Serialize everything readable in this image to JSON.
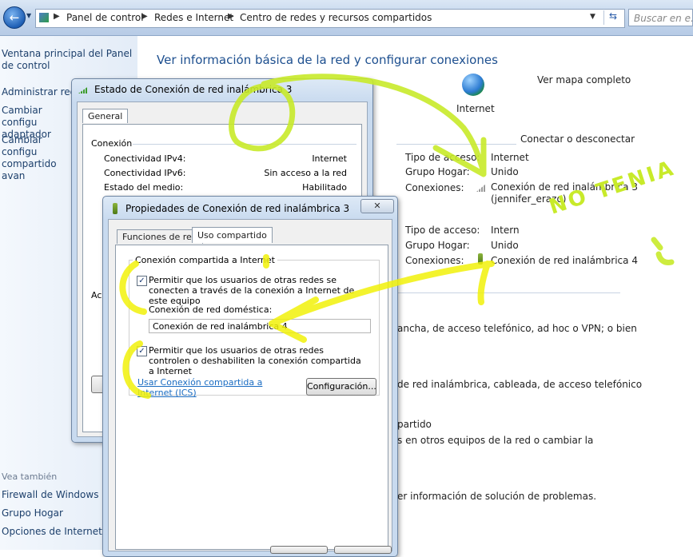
{
  "addressbar": {
    "crumbs": [
      "Panel de control",
      "Redes e Internet",
      "Centro de redes y recursos compartidos"
    ],
    "search_placeholder": "Buscar en e..."
  },
  "leftpane": {
    "items": [
      "Ventana principal del Panel de control",
      "Administrar rede",
      "Cambiar configu adaptador",
      "Cambiar configu compartido avan"
    ],
    "see_also_header": "Vea también",
    "see_also": [
      "Firewall de Windows",
      "Grupo Hogar",
      "Opciones de Internet"
    ]
  },
  "main": {
    "title": "Ver información básica de la red y configurar conexiones",
    "view_map_link": "Ver mapa completo",
    "internet_label": "Internet",
    "connect_link": "Conectar o desconectar",
    "network1": {
      "access_type_label": "Tipo de acceso:",
      "access_type_value": "Internet",
      "homegroup_label": "Grupo Hogar:",
      "homegroup_value": "Unido",
      "connections_label": "Conexiones:",
      "connection_line1": "Conexión de red inalámbrica 3",
      "connection_line2": "(jennifer_erazo)"
    },
    "network2": {
      "access_type_label": "Tipo de acceso:",
      "access_type_value": "Intern",
      "homegroup_label": "Grupo Hogar:",
      "homegroup_value": "Unido",
      "connections_label": "Conexiones:",
      "connection_value": "Conexión de red inalámbrica 4"
    },
    "task_texts": [
      "ancha, de acceso telefónico, ad hoc o VPN; o bien",
      "de red inalámbrica, cableada, de acceso telefónico",
      "partido",
      "s en otros equipos de la red o cambiar la",
      "er información de solución de problemas."
    ]
  },
  "status_dialog": {
    "title": "Estado de Conexión de red inalámbrica 3",
    "tab": "General",
    "section": "Conexión",
    "rows": [
      {
        "label": "Conectividad IPv4:",
        "value": "Internet"
      },
      {
        "label": "Conectividad IPv6:",
        "value": "Sin acceso a la red"
      },
      {
        "label": "Estado del medio:",
        "value": "Habilitado"
      }
    ],
    "partial_label": "Ac"
  },
  "props_dialog": {
    "title": "Propiedades de Conexión de red inalámbrica 3",
    "tabs": [
      "Funciones de red",
      "Uso compartido"
    ],
    "group_title": "Conexión compartida a Internet",
    "check1": "Permitir que los usuarios de otras redes se conecten a través de la conexión a Internet de este equipo",
    "home_label": "Conexión de red doméstica:",
    "home_value": "Conexión de red inalámbrica 4",
    "check2": "Permitir que los usuarios de otras redes controlen o deshabiliten la conexión compartida a Internet",
    "ics_link": "Usar Conexión compartida a Internet (ICS)",
    "config_button": "Configuración..."
  },
  "annotation": {
    "text": "NO TENIA"
  },
  "colors": {
    "highlighter_yellow": "#f2f20a",
    "highlighter_green": "#c8ea2a",
    "link_blue": "#0b5cb8"
  }
}
